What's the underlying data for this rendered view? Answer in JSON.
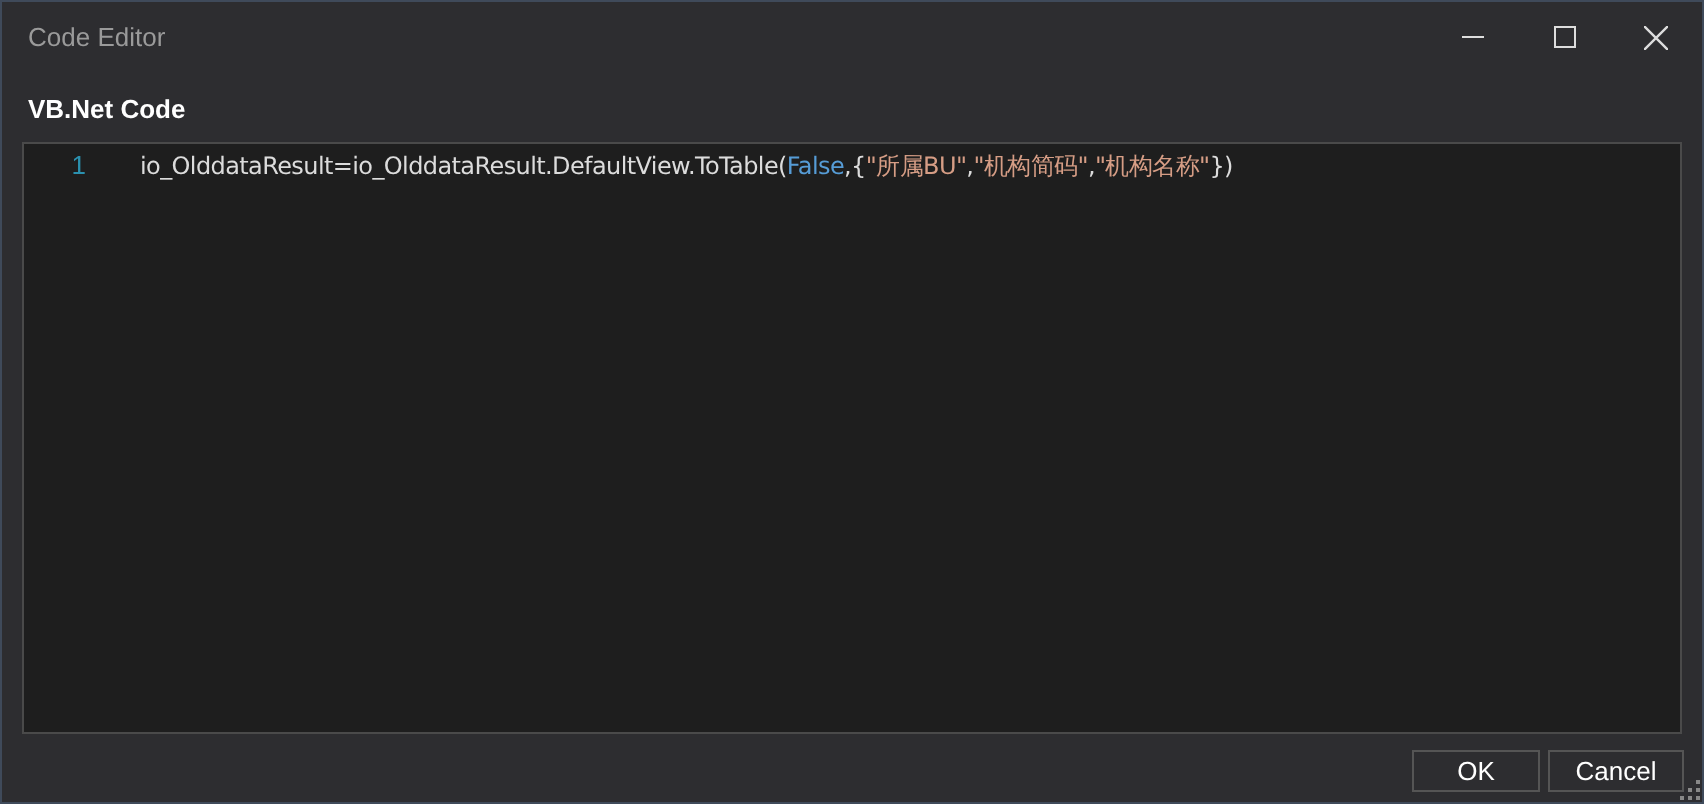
{
  "window": {
    "title": "Code Editor"
  },
  "editor": {
    "label": "VB.Net Code",
    "lines": [
      {
        "number": "1",
        "tokens": [
          {
            "kind": "plain",
            "text": "io_OlddataResult=io_OlddataResult.DefaultView.ToTable("
          },
          {
            "kind": "keyword",
            "text": "False"
          },
          {
            "kind": "plain",
            "text": ",{"
          },
          {
            "kind": "string",
            "text": "\"所属BU\""
          },
          {
            "kind": "string",
            "separator": ",",
            "text": "\"机构简码\""
          },
          {
            "kind": "string",
            "separator": ",",
            "text": "\"机构名称\""
          },
          {
            "kind": "plain",
            "text": "})"
          }
        ]
      }
    ]
  },
  "buttons": [
    "OK",
    "Cancel"
  ]
}
